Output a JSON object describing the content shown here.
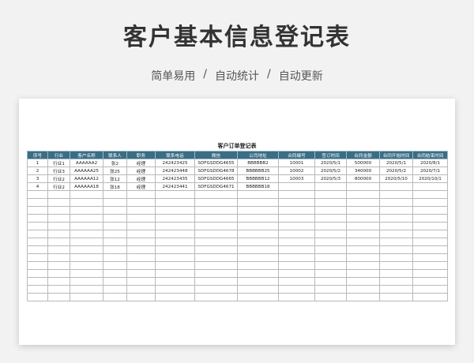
{
  "hero": {
    "title": "客户基本信息登记表",
    "subtitle": [
      "简单易用",
      "/",
      "自动统计",
      "/",
      "自动更新"
    ]
  },
  "sheet": {
    "title": "客户订单登记表",
    "columns": [
      "序号",
      "行业",
      "客户名称",
      "联系人",
      "职务",
      "联系电话",
      "微信",
      "公司地址",
      "合同编号",
      "签订时间",
      "合同金额",
      "合同开始时间",
      "合同结束时间"
    ],
    "rows": [
      [
        "1",
        "行业1",
        "AAAAAA2",
        "张2",
        "经理",
        "242423425",
        "SDFGSDDG4655",
        "BBBBBB2",
        "10001",
        "2020/5/1",
        "500000",
        "2020/5/1",
        "2020/8/1"
      ],
      [
        "2",
        "行业3",
        "AAAAAA25",
        "张25",
        "经理",
        "242423448",
        "SDFGSDDG4678",
        "BBBBBB25",
        "10002",
        "2020/5/2",
        "340000",
        "2020/5/2",
        "2020/7/1"
      ],
      [
        "3",
        "行业2",
        "AAAAAA12",
        "张12",
        "经理",
        "242423435",
        "SDFGSDDG4665",
        "BBBBBB12",
        "10003",
        "2020/5/3",
        "800000",
        "2020/5/10",
        "2020/10/1"
      ],
      [
        "4",
        "行业2",
        "AAAAAA18",
        "张18",
        "经理",
        "242423441",
        "SDFGSDDG4671",
        "BBBBBB18",
        "",
        "",
        "",
        "",
        ""
      ]
    ],
    "empty_row_count": 14
  },
  "colors": {
    "header_bg": "#3b6d85",
    "header_text": "#ffffff"
  }
}
